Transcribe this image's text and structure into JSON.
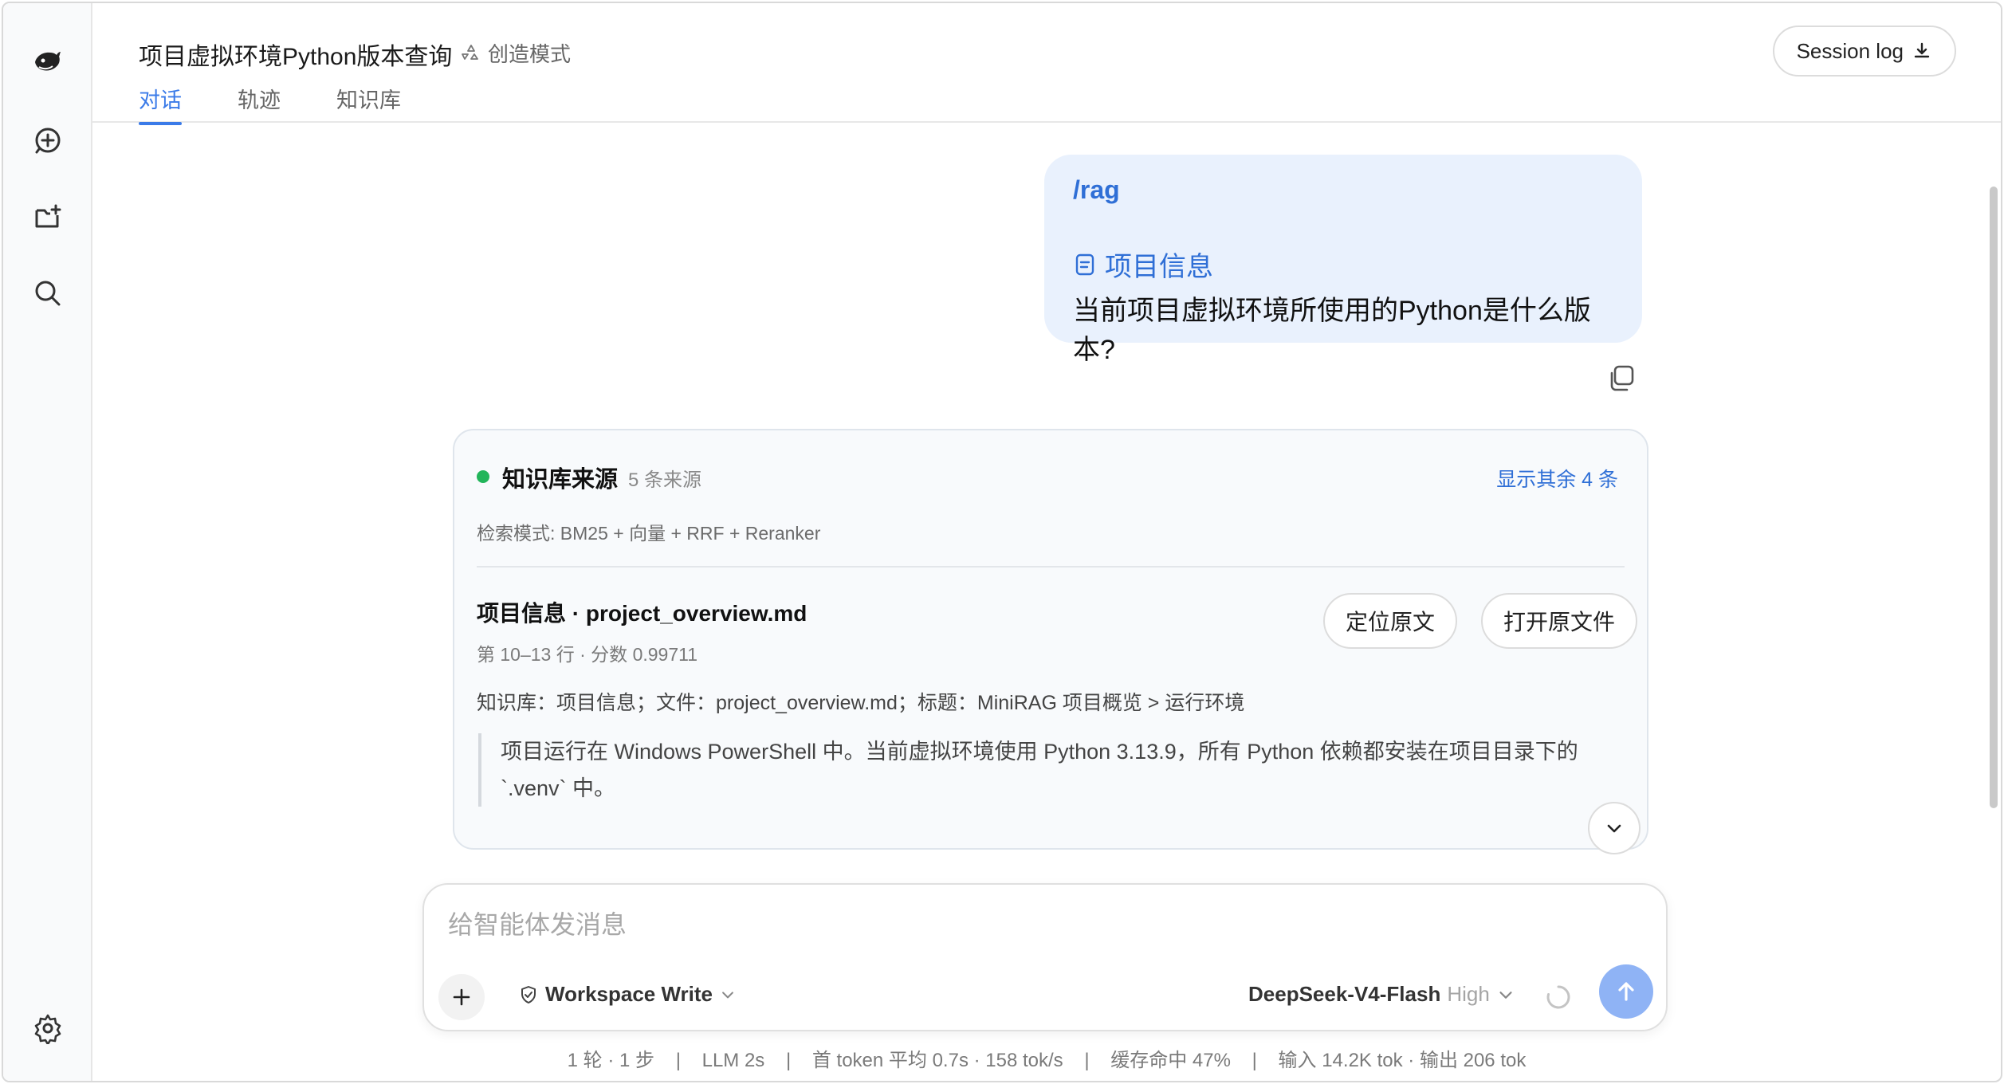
{
  "header": {
    "title": "项目虚拟环境Python版本查询",
    "mode_label": "创造模式",
    "session_log_label": "Session log"
  },
  "tabs": [
    {
      "label": "对话",
      "active": true
    },
    {
      "label": "轨迹",
      "active": false
    },
    {
      "label": "知识库",
      "active": false
    }
  ],
  "user_message": {
    "command": "/rag",
    "reference_label": "项目信息",
    "question": "当前项目虚拟环境所使用的Python是什么版本?"
  },
  "kb_card": {
    "title": "知识库来源",
    "count": "5 条来源",
    "show_more": "显示其余 4 条",
    "search_mode": "检索模式: BM25 + 向量 + RRF + Reranker",
    "source": {
      "title": "项目信息 · project_overview.md",
      "meta": "第 10–13 行 · 分数 0.99711",
      "locate_label": "定位原文",
      "open_label": "打开原文件",
      "path": "知识库：项目信息；文件：project_overview.md；标题：MiniRAG 项目概览 > 运行环境",
      "quote": "项目运行在 Windows PowerShell 中。当前虚拟环境使用 Python 3.13.9，所有 Python 依赖都安装在项目目录下的 `.venv` 中。"
    }
  },
  "composer": {
    "placeholder": "给智能体发消息",
    "workspace_label": "Workspace Write",
    "model_name": "DeepSeek-V4-Flash",
    "model_level": "High"
  },
  "stats": {
    "turns": "1 轮 · 1 步",
    "llm": "LLM 2s",
    "token": "首 token 平均 0.7s · 158 tok/s",
    "cache": "缓存命中 47%",
    "io": "输入 14.2K tok · 输出 206 tok",
    "separator": "|"
  },
  "colors": {
    "accent": "#3b7be8",
    "bubble_bg": "#e9f1fd",
    "status_green": "#22b55a",
    "send_button": "#8fb3f5"
  }
}
